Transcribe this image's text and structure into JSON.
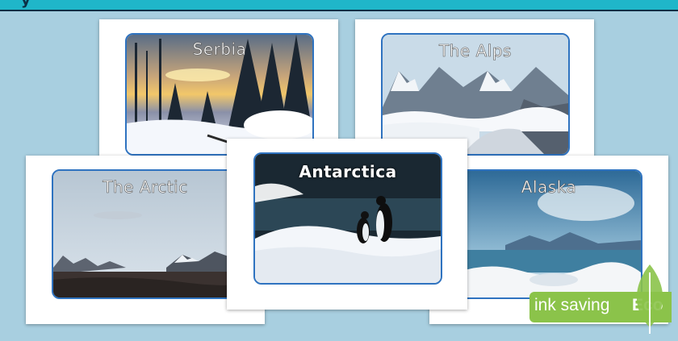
{
  "header": {
    "text": "y"
  },
  "cards": {
    "serbia": {
      "label": "Serbia"
    },
    "alps": {
      "label": "The Alps"
    },
    "arctic": {
      "label": "The Arctic"
    },
    "antarctica": {
      "label": "Antarctica"
    },
    "alaska": {
      "label": "Alaska"
    }
  },
  "badge": {
    "ink_label": "ink saving",
    "eco_label": "Eco"
  },
  "colors": {
    "background": "#a8cfe0",
    "frame": "#2f73c0",
    "badge": "#8bc34a"
  }
}
